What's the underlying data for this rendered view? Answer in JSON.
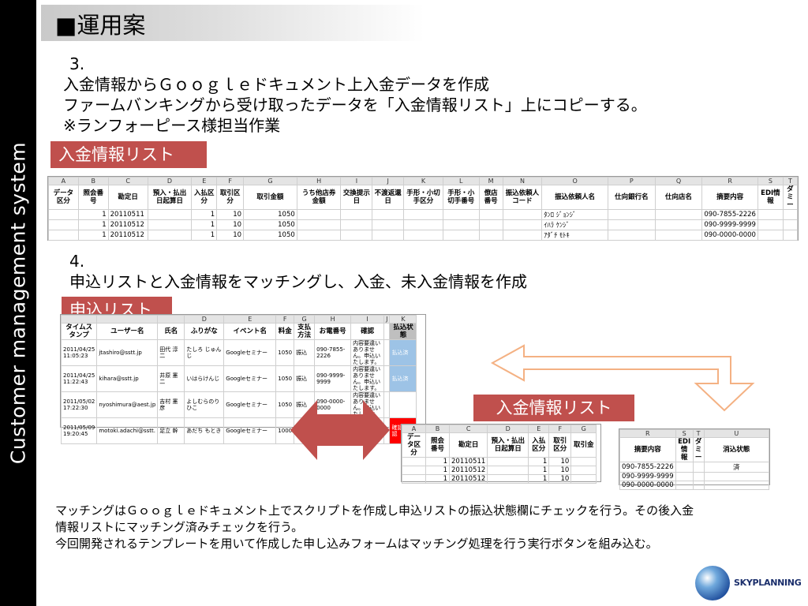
{
  "sidebar": {
    "text": "Customer management system"
  },
  "title": "■運用案",
  "step3": {
    "number": "3.",
    "lines": [
      "入金情報からＧｏｏｇｌｅドキュメント上入金データを作成",
      "ファームバンキングから受け取ったデータを「入金情報リスト」上にコピーする。",
      "※ランフォーピース様担当作業"
    ]
  },
  "label_payment_list": "入金情報リスト",
  "sheet1": {
    "col_letters": [
      "A",
      "B",
      "C",
      "D",
      "E",
      "F",
      "G",
      "H",
      "I",
      "J",
      "K",
      "L",
      "M",
      "N",
      "O",
      "P",
      "Q",
      "R",
      "S",
      "T"
    ],
    "headers": [
      "データ区分",
      "照会番号",
      "勘定日",
      "預入・払出日起算日",
      "入払区分",
      "取引区分",
      "取引金額",
      "うち他店券金額",
      "交換提示日",
      "不渡返還日",
      "手形・小切手区分",
      "手形・小切手番号",
      "僚店番号",
      "振込依頼人コード",
      "振込依頼人名",
      "仕向銀行名",
      "仕向店名",
      "摘要内容",
      "EDI情報",
      "ダミー"
    ],
    "rows": [
      [
        "",
        "1",
        "20110511",
        "",
        "1",
        "10",
        "1050",
        "",
        "",
        "",
        "",
        "",
        "",
        "",
        "ﾀﾝﾛ ｼﾞｮﾝｼﾞ",
        "",
        "",
        "090-7855-2226",
        "",
        ""
      ],
      [
        "",
        "1",
        "20110512",
        "",
        "1",
        "10",
        "1050",
        "",
        "",
        "",
        "",
        "",
        "",
        "",
        "ｲﾊﾗ ｹﾝｼﾞ",
        "",
        "",
        "090-9999-9999",
        "",
        ""
      ],
      [
        "",
        "1",
        "20110512",
        "",
        "1",
        "10",
        "1050",
        "",
        "",
        "",
        "",
        "",
        "",
        "",
        "ｱﾀﾞﾁ ﾓﾄｷ",
        "",
        "",
        "090-0000-0000",
        "",
        ""
      ]
    ]
  },
  "step4": {
    "number": "4.",
    "line": "申込リストと入金情報をマッチングし、入金、未入金情報を作成"
  },
  "label_application_list": "申込リスト",
  "sheet2": {
    "col_letters": [
      "",
      "",
      "",
      "D",
      "E",
      "F",
      "G",
      "H",
      "I",
      "J",
      "K"
    ],
    "headers": [
      "タイムスタンプ",
      "ユーザー名",
      "氏名",
      "ふりがな",
      "イベント名",
      "料金",
      "支払方法",
      "お電番号",
      "確認",
      "",
      "払込状態"
    ],
    "rows": [
      [
        "2011/04/25 11:05:23",
        "jtashiro@sstt.jp",
        "田代 淳二",
        "たしろ じゅんじ",
        "Googleセミナー",
        "1050",
        "振込",
        "090-7855-2226",
        "内容要違いありません。申込いたします。",
        "",
        "払込済"
      ],
      [
        "2011/04/25 11:22:43",
        "kihara@sstt.jp",
        "井原 憲二",
        "いはらけんじ",
        "Googleセミナー",
        "1050",
        "振込",
        "090-9999-9999",
        "内容要違いありません。申込いたします。",
        "",
        "払込済"
      ],
      [
        "2011/05/02 17:22:30",
        "nyoshimura@aest.jp",
        "吉村 憲彦",
        "よしむらのりひこ",
        "Googleセミナー",
        "1050",
        "振込",
        "090-0000-0000",
        "内容要違いありません。申込いたします。",
        "",
        ""
      ],
      [
        "2011/05/09 19:20:45",
        "motoki.adachi@sstt.",
        "足立 幹",
        "あだち もとき",
        "Googleセミナー",
        "1000",
        "振",
        "",
        "内容要違いありません。申込いたします。",
        "",
        "確認要確認"
      ]
    ]
  },
  "label_payment_list2": "入金情報リスト",
  "sheet3": {
    "col_letters": [
      "A",
      "B",
      "C",
      "D",
      "E",
      "F",
      "G"
    ],
    "headers": [
      "データ区分",
      "照会番号",
      "勘定日",
      "預入・払出日起算日",
      "入払区分",
      "取引区分",
      "取引金"
    ],
    "rows": [
      [
        "",
        "1",
        "20110511",
        "",
        "1",
        "10",
        ""
      ],
      [
        "",
        "1",
        "20110512",
        "",
        "1",
        "10",
        ""
      ],
      [
        "",
        "1",
        "20110512",
        "",
        "1",
        "10",
        ""
      ]
    ]
  },
  "sheet4": {
    "col_letters": [
      "R",
      "S",
      "T",
      "U"
    ],
    "headers": [
      "摘要内容",
      "EDI情報",
      "ダミー",
      "消込状態"
    ],
    "rows": [
      [
        "090-7855-2226",
        "",
        "",
        "済"
      ],
      [
        "090-9999-9999",
        "",
        "",
        ""
      ],
      [
        "090-0000-0000",
        "",
        "",
        ""
      ]
    ]
  },
  "description": [
    "マッチングはＧｏｏｇｌｅドキュメント上でスクリプトを作成し申込リストの振込状態欄にチェックを行う。その後入金",
    "情報リストにマッチング済みチェックを行う。",
    "今回開発されるテンプレートを用いて作成した申し込みフォームはマッチング処理を行う実行ボタンを組み込む。"
  ],
  "logo": {
    "text": "SKYPLANNING"
  },
  "colors": {
    "accent_red": "#c0504d",
    "arrow_orange": "#f4b183",
    "cell_blue": "#9dc3e6",
    "cell_red": "#ff0000"
  }
}
